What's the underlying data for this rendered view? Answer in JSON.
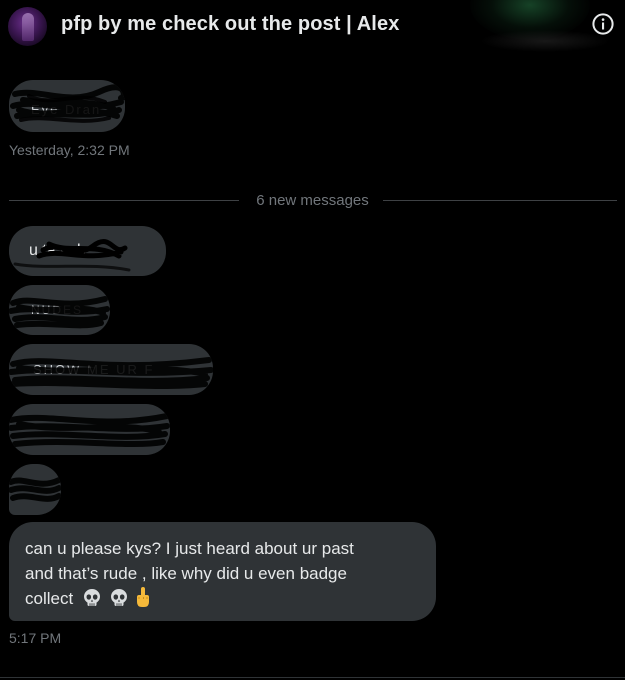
{
  "conversation": {
    "title": "pfp by me check out the post | Alex",
    "info_icon": "info-circle-icon"
  },
  "messages": {
    "first_bubble_text": "Eye Dran",
    "first_timestamp": "Yesterday, 2:32 PM",
    "new_messages_label": "6 new messages",
    "censored_1_text": "u ta     uch",
    "censored_2_text": "NUDES",
    "censored_3_text": "SHOW ME UR F",
    "censored_4_text": "",
    "censored_5_text": "",
    "main_message_lines": [
      "can u please kys? I just heard about ur past",
      "and that’s rude , like why did u even badge",
      "collect"
    ],
    "main_message_emoji": [
      "skull-emoji",
      "skull-emoji",
      "middle-finger-emoji"
    ],
    "last_timestamp": "5:17 PM"
  },
  "colors": {
    "background": "#000000",
    "bubble": "#2f3336",
    "text": "#e7e9ea",
    "muted": "#71767b"
  }
}
